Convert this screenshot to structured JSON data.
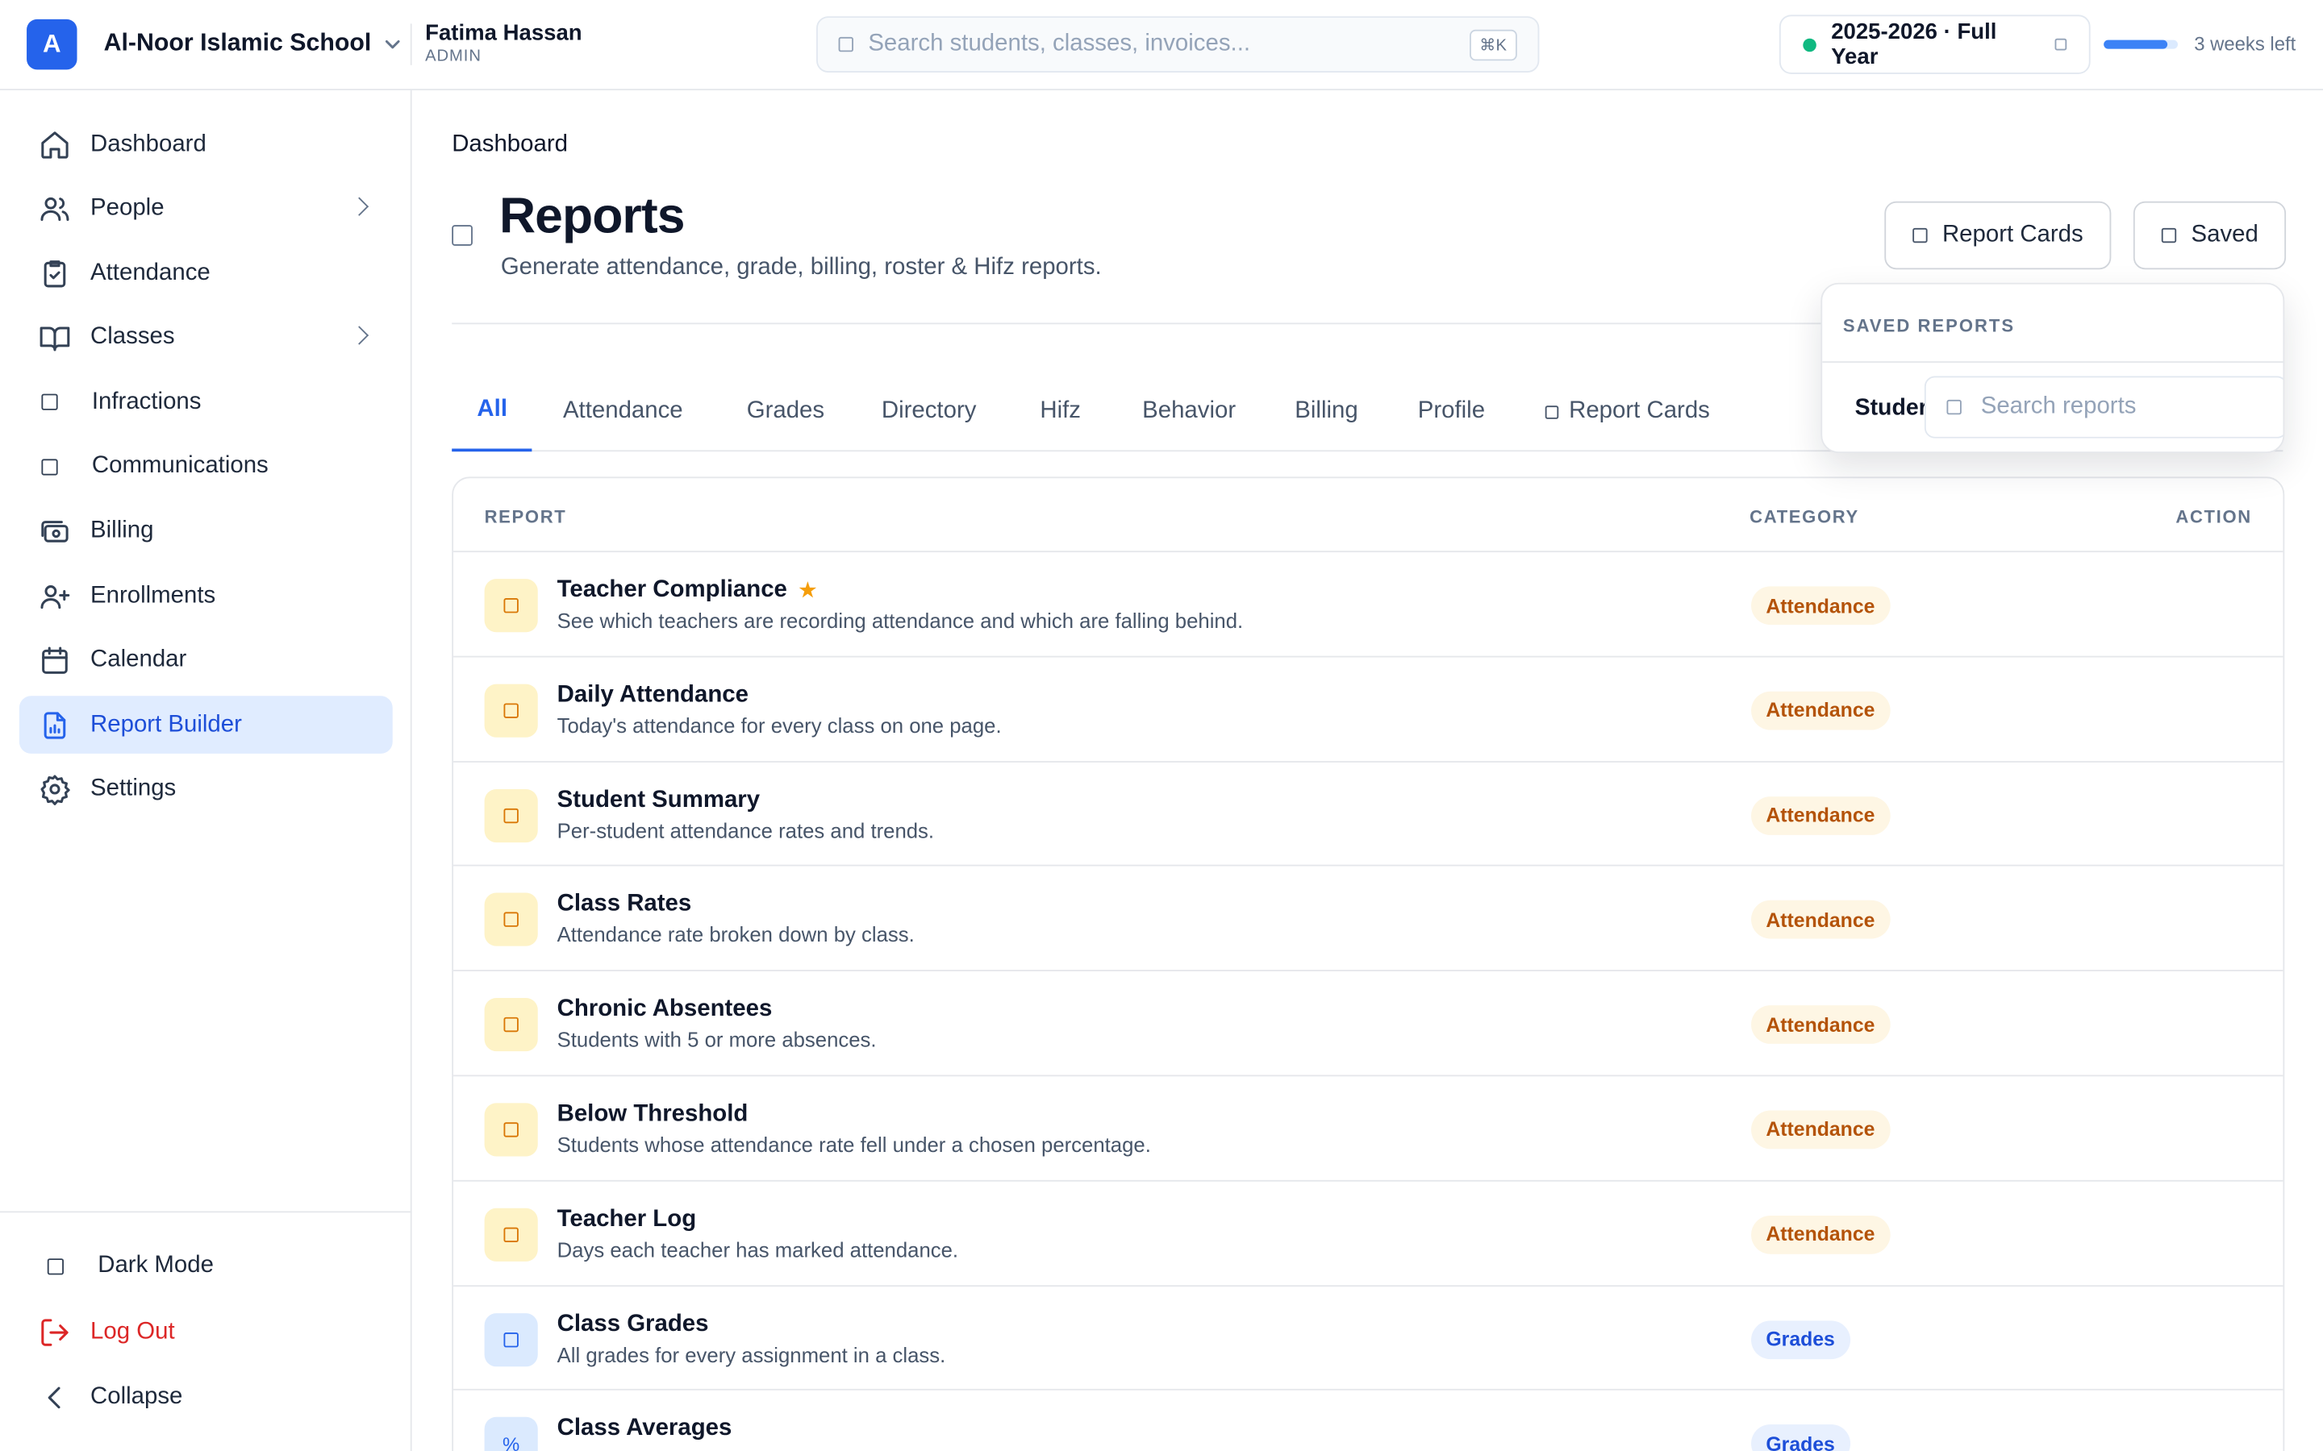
{
  "topbar": {
    "logo_letter": "A",
    "school_name": "Al-Noor Islamic School",
    "user_name": "Fatima Hassan",
    "user_role": "ADMIN",
    "search_placeholder": "Search students, classes, invoices...",
    "search_shortcut": "⌘K",
    "school_year": "2025-2026 · Full Year",
    "term_progress_percent": 85,
    "term_remaining": "3 weeks left"
  },
  "sidebar": {
    "items": [
      {
        "label": "Dashboard",
        "icon": "home-icon"
      },
      {
        "label": "People",
        "icon": "users-icon",
        "expandable": true
      },
      {
        "label": "Attendance",
        "icon": "clipboard-check-icon"
      },
      {
        "label": "Classes",
        "icon": "book-open-icon",
        "expandable": true
      },
      {
        "label": "Infractions",
        "icon": "placeholder-icon"
      },
      {
        "label": "Communications",
        "icon": "placeholder-icon"
      },
      {
        "label": "Billing",
        "icon": "billing-icon"
      },
      {
        "label": "Enrollments",
        "icon": "user-plus-icon"
      },
      {
        "label": "Calendar",
        "icon": "calendar-icon"
      },
      {
        "label": "Report Builder",
        "icon": "report-file-icon",
        "active": true
      },
      {
        "label": "Settings",
        "icon": "gear-icon"
      }
    ],
    "bottom": {
      "dark_mode": "Dark Mode",
      "logout": "Log Out",
      "collapse": "Collapse"
    },
    "colors": {
      "active_bg": "#e0ecff",
      "active_text": "#1d4ed8",
      "logout": "#dc2626"
    }
  },
  "main": {
    "breadcrumb": "Dashboard",
    "title": "Reports",
    "subtitle": "Generate attendance, grade, billing, roster & Hifz reports.",
    "buttons": {
      "report_cards": "Report Cards",
      "saved": "Saved"
    },
    "tabs": [
      "All",
      "Attendance",
      "Grades",
      "Directory",
      "Hifz",
      "Behavior",
      "Billing",
      "Profile",
      "Report Cards"
    ],
    "active_tab": "All",
    "table": {
      "headers": {
        "report": "REPORT",
        "category": "CATEGORY",
        "action": "ACTION"
      },
      "rows": [
        {
          "name": "Teacher Compliance",
          "starred": true,
          "star": "★",
          "description": "See which teachers are recording attendance and which are falling behind.",
          "category": "Attendance",
          "tone": "amber",
          "icon_glyph": ""
        },
        {
          "name": "Daily Attendance",
          "description": "Today's attendance for every class on one page.",
          "category": "Attendance",
          "tone": "amber",
          "icon_glyph": ""
        },
        {
          "name": "Student Summary",
          "description": "Per-student attendance rates and trends.",
          "category": "Attendance",
          "tone": "amber",
          "icon_glyph": ""
        },
        {
          "name": "Class Rates",
          "description": "Attendance rate broken down by class.",
          "category": "Attendance",
          "tone": "amber",
          "icon_glyph": ""
        },
        {
          "name": "Chronic Absentees",
          "description": "Students with 5 or more absences.",
          "category": "Attendance",
          "tone": "amber",
          "icon_glyph": ""
        },
        {
          "name": "Below Threshold",
          "description": "Students whose attendance rate fell under a chosen percentage.",
          "category": "Attendance",
          "tone": "amber",
          "icon_glyph": ""
        },
        {
          "name": "Teacher Log",
          "description": "Days each teacher has marked attendance.",
          "category": "Attendance",
          "tone": "amber",
          "icon_glyph": ""
        },
        {
          "name": "Class Grades",
          "description": "All grades for every assignment in a class.",
          "category": "Grades",
          "tone": "blue",
          "icon_glyph": ""
        },
        {
          "name": "Class Averages",
          "description": "",
          "category": "Grades",
          "tone": "blue",
          "icon_glyph": "%"
        }
      ]
    }
  },
  "saved_popover": {
    "heading": "SAVED REPORTS",
    "item_label": "Studer",
    "search_placeholder": "Search reports"
  },
  "colors": {
    "accent": "#2563eb",
    "attendance_badge": "#b45309",
    "grades_badge": "#1d4ed8",
    "status_dot": "#10b981"
  }
}
